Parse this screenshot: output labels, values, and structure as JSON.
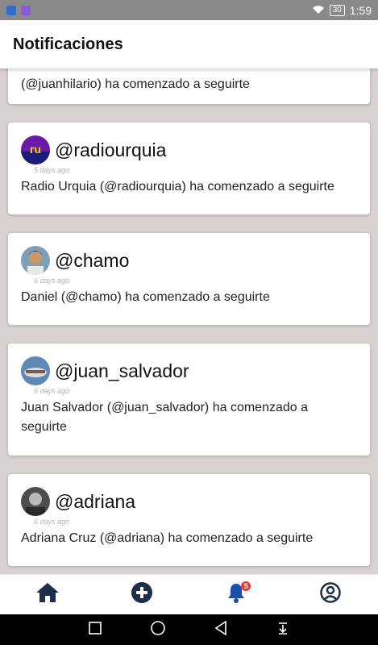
{
  "status_bar": {
    "battery": "30",
    "time": "1:59"
  },
  "header": {
    "title": "Notificaciones"
  },
  "notifications": [
    {
      "handle": "",
      "time": "",
      "message": " (@juanhilario) ha comenzado a seguirte"
    },
    {
      "handle": "@radiourquia",
      "time": "5 days ago",
      "message": "Radio Urquia (@radiourquia) ha comenzado a seguirte"
    },
    {
      "handle": "@chamo",
      "time": "6 days ago",
      "message": "Daniel  (@chamo) ha comenzado a seguirte"
    },
    {
      "handle": "@juan_salvador",
      "time": "6 days ago",
      "message": "Juan Salvador  (@juan_salvador) ha comenzado a seguirte"
    },
    {
      "handle": "@adriana",
      "time": "6 days ago",
      "message": "Adriana Cruz (@adriana) ha comenzado a seguirte"
    }
  ],
  "bottom_nav": {
    "items": [
      {
        "icon": "home-icon"
      },
      {
        "icon": "add-circle-icon"
      },
      {
        "icon": "bell-icon",
        "badge": "5"
      },
      {
        "icon": "user-circle-icon"
      }
    ]
  },
  "colors": {
    "background": "#d9d2d3",
    "nav_icon": "#1f2d4a",
    "active_icon": "#1a4fae",
    "badge": "#e53935"
  }
}
